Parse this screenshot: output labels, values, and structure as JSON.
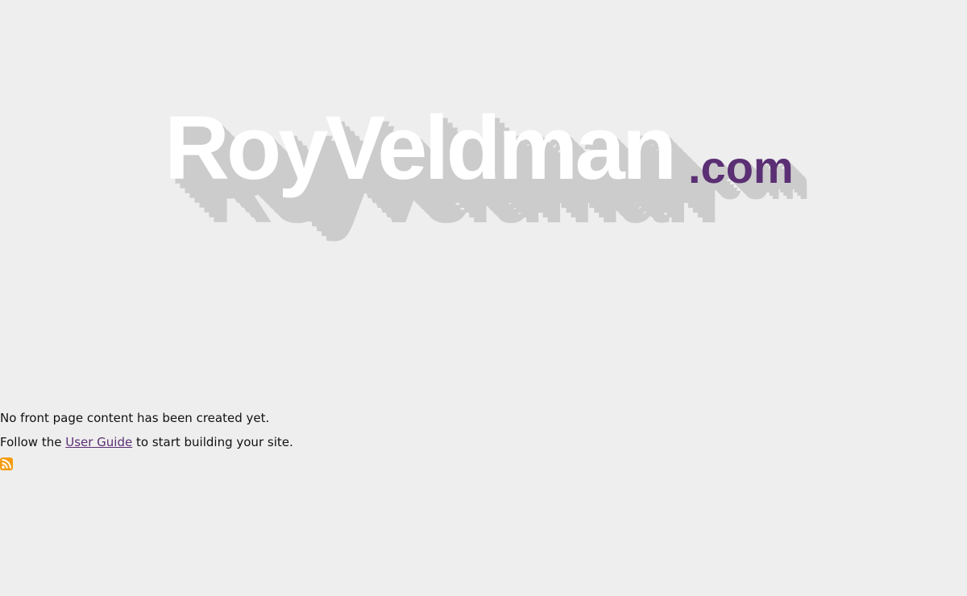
{
  "logo": {
    "name": "RoyVeldman",
    "tld": ".com"
  },
  "content": {
    "empty_message": "No front page content has been created yet.",
    "guide_prefix": "Follow the ",
    "guide_link_label": "User Guide",
    "guide_suffix": " to start building your site."
  },
  "feed": {
    "icon": "rss-feed-icon",
    "color": "#f39c12"
  },
  "colors": {
    "background": "#eeeeee",
    "logo_text": "#ffffff",
    "logo_shadow": "#cccccc",
    "accent": "#5b2f74"
  }
}
